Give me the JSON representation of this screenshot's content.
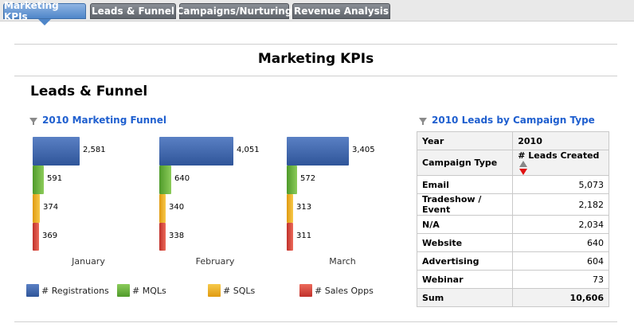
{
  "tabs": [
    {
      "label": "Marketing KPIs",
      "active": true
    },
    {
      "label": "Leads & Funnel",
      "active": false
    },
    {
      "label": "Campaigns/Nurturing",
      "active": false
    },
    {
      "label": "Revenue Analysis",
      "active": false
    }
  ],
  "page_title": "Marketing KPIs",
  "section_title": "Leads & Funnel",
  "funnel": {
    "title": "2010 Marketing Funnel",
    "icon": "filter-icon",
    "colors": {
      "registrations": "#3f67ad",
      "mqls": "#6db33f",
      "sqls": "#f0b323",
      "sales_opps": "#d9443a"
    },
    "legend": [
      "# Registrations",
      "# MQLs",
      "# SQLs",
      "# Sales Opps"
    ],
    "months": [
      {
        "name": "January",
        "values": [
          "2,581",
          "591",
          "374",
          "369"
        ]
      },
      {
        "name": "February",
        "values": [
          "4,051",
          "640",
          "340",
          "338"
        ]
      },
      {
        "name": "March",
        "values": [
          "3,405",
          "572",
          "313",
          "311"
        ]
      }
    ]
  },
  "chart_data": {
    "type": "bar",
    "title": "2010 Marketing Funnel",
    "categories": [
      "January",
      "February",
      "March"
    ],
    "series": [
      {
        "name": "# Registrations",
        "values": [
          2581,
          4051,
          3405
        ]
      },
      {
        "name": "# MQLs",
        "values": [
          591,
          640,
          572
        ]
      },
      {
        "name": "# SQLs",
        "values": [
          374,
          340,
          313
        ]
      },
      {
        "name": "# Sales Opps",
        "values": [
          369,
          338,
          311
        ]
      }
    ]
  },
  "leads_table": {
    "title": "2010 Leads by Campaign Type",
    "icon": "filter-icon",
    "year_label": "Year",
    "year_value": "2010",
    "col_type": "Campaign Type",
    "col_leads": "# Leads Created",
    "rows": [
      {
        "type": "Email",
        "leads": "5,073"
      },
      {
        "type": "Tradeshow / Event",
        "leads": "2,182"
      },
      {
        "type": "N/A",
        "leads": "2,034"
      },
      {
        "type": "Website",
        "leads": "640"
      },
      {
        "type": "Advertising",
        "leads": "604"
      },
      {
        "type": "Webinar",
        "leads": "73"
      }
    ],
    "sum_label": "Sum",
    "sum_value": "10,606"
  }
}
